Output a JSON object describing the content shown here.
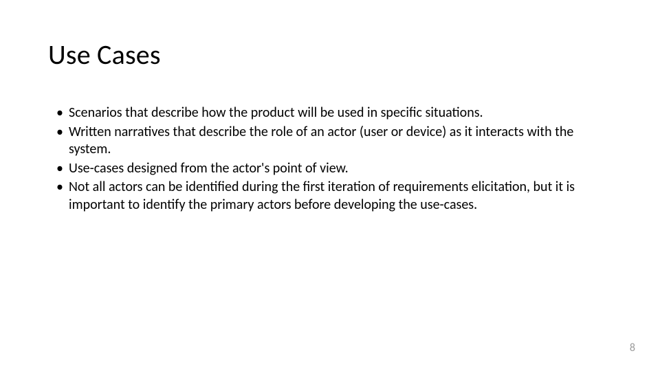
{
  "title": "Use Cases",
  "bullets": [
    "Scenarios that describe how the product will be used in specific situations.",
    "Written narratives that describe the role of an actor (user or device) as it interacts with the system.",
    "Use-cases designed from the actor's point of view.",
    "Not all actors can be identified during the first iteration of requirements elicitation, but it is important to identify the primary actors before developing the use-cases."
  ],
  "page_number": "8"
}
